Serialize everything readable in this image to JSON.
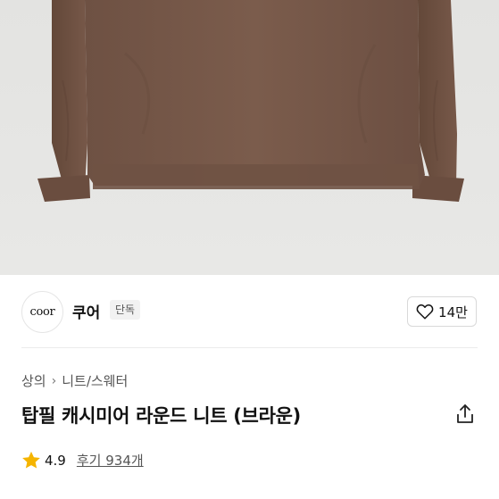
{
  "brand": {
    "logo_text": "coor",
    "name": "쿠어",
    "badge": "단독"
  },
  "like": {
    "count": "14만",
    "icon": "heart-outline-icon"
  },
  "breadcrumb": {
    "category": "상의",
    "subcategory": "니트/스웨터",
    "separator": "›"
  },
  "product": {
    "title": "탑필 캐시미어 라운드 니트 (브라운)"
  },
  "rating": {
    "score": "4.9",
    "reviews": "후기 934개",
    "star_color": "#f5b400"
  },
  "colors": {
    "sweater": "#7a5a4a",
    "background": "#e6e6e4"
  }
}
